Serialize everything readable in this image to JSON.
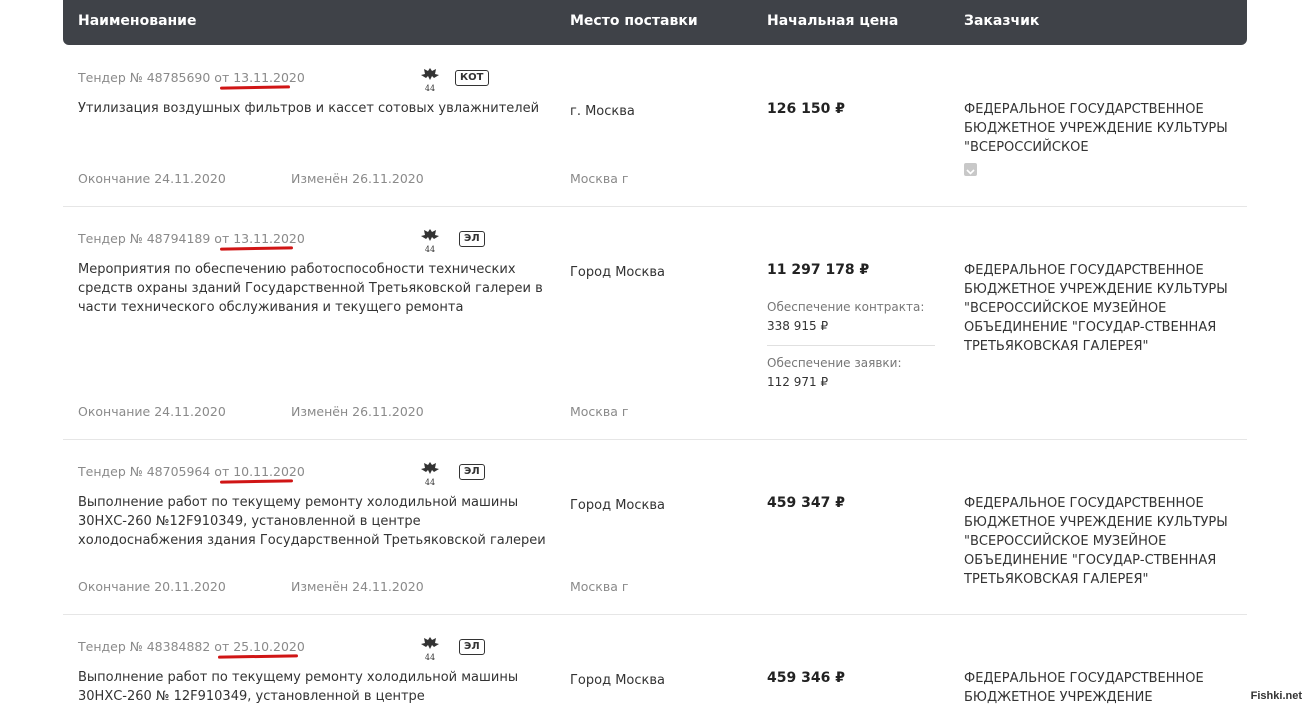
{
  "header": {
    "col_name": "Наименование",
    "col_place": "Место поставки",
    "col_price": "Начальная цена",
    "col_customer": "Заказчик"
  },
  "tenders": [
    {
      "number_prefix": "Тендер № 48785690 от",
      "date": "13.11.2020",
      "law": "44",
      "badge": "КОТ",
      "title": "Утилизация воздушных фильтров и кассет сотовых увлажнителей",
      "place": "г. Москва",
      "price": "126 150 ₽",
      "customer": "ФЕДЕРАЛЬНОЕ ГОСУДАРСТВЕННОЕ БЮДЖЕТНОЕ УЧРЕЖДЕНИЕ КУЛЬТУРЫ \"ВСЕРОССИЙСКОЕ",
      "end": "Окончание 24.11.2020",
      "changed": "Изменён 26.11.2020",
      "region": "Москва г"
    },
    {
      "number_prefix": "Тендер № 48794189 от",
      "date": "13.11.2020",
      "law": "44",
      "badge": "ЭЛ",
      "title": "Мероприятия по обеспечению работоспособности технических средств охраны зданий Государственной Третьяковской галереи в части технического обслуживания и текущего ремонта",
      "place": "Город Москва",
      "price": "11 297 178 ₽",
      "contract_security_label": "Обеспечение контракта:",
      "contract_security": "338 915 ₽",
      "bid_security_label": "Обеспечение заявки:",
      "bid_security": "112 971 ₽",
      "customer": "ФЕДЕРАЛЬНОЕ ГОСУДАРСТВЕННОЕ БЮДЖЕТНОЕ УЧРЕЖДЕНИЕ КУЛЬТУРЫ \"ВСЕРОССИЙСКОЕ МУЗЕЙНОЕ ОБЪЕДИНЕНИЕ \"ГОСУДАР-СТВЕННАЯ ТРЕТЬЯКОВСКАЯ ГАЛЕРЕЯ\"",
      "end": "Окончание 24.11.2020",
      "changed": "Изменён 26.11.2020",
      "region": "Москва г"
    },
    {
      "number_prefix": "Тендер № 48705964 от",
      "date": "10.11.2020",
      "law": "44",
      "badge": "ЭЛ",
      "title": "Выполнение работ по текущему ремонту холодильной машины 30НХС-260 №12F910349, установленной в центре холодоснабжения здания Государственной Третьяковской галереи",
      "place": "Город Москва",
      "price": "459 347 ₽",
      "customer": "ФЕДЕРАЛЬНОЕ ГОСУДАРСТВЕННОЕ БЮДЖЕТНОЕ УЧРЕЖДЕНИЕ КУЛЬТУРЫ \"ВСЕРОССИЙСКОЕ МУЗЕЙНОЕ ОБЪЕДИНЕНИЕ \"ГОСУДАР-СТВЕННАЯ ТРЕТЬЯКОВСКАЯ ГАЛЕРЕЯ\"",
      "end": "Окончание 20.11.2020",
      "changed": "Изменён 24.11.2020",
      "region": "Москва г"
    },
    {
      "number_prefix": "Тендер № 48384882 от",
      "date": "25.10.2020",
      "law": "44",
      "badge": "ЭЛ",
      "title": "Выполнение работ по текущему ремонту холодильной машины 30НХС-260 № 12F910349, установленной в центре",
      "place": "Город Москва",
      "price": "459 346 ₽",
      "customer": "ФЕДЕРАЛЬНОЕ ГОСУДАРСТВЕННОЕ БЮДЖЕТНОЕ УЧРЕЖДЕНИЕ"
    }
  ],
  "watermark": "Fishki.net",
  "colors": {
    "header_bg": "#3f4248",
    "underline": "#d01515"
  }
}
